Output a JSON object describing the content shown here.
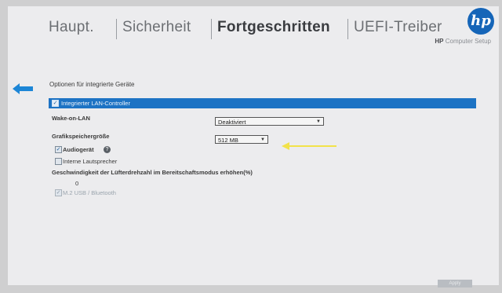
{
  "tabs": [
    {
      "label": "Haupt."
    },
    {
      "label": "Sicherheit"
    },
    {
      "label": "Fortgeschritten"
    },
    {
      "label": "UEFI-Treiber"
    }
  ],
  "brand": {
    "strong": "HP",
    "text": "Computer Setup",
    "logo": "hp"
  },
  "page_title": "Optionen für integrierte Geräte",
  "rows": {
    "lan": {
      "label": "Integrierter LAN-Controller",
      "checked": true
    },
    "wol": {
      "label": "Wake-on-LAN",
      "value": "Deaktiviert"
    },
    "gfx": {
      "label": "Grafikspeichergröße",
      "value": "512 MB"
    },
    "audio": {
      "label": "Audiogerät",
      "checked": true
    },
    "speaker": {
      "label": "Interne Lautsprecher",
      "checked": false
    },
    "fan": {
      "label": "Geschwindigkeit der Lüfterdrehzahl im Bereitschaftsmodus erhöhen(%)",
      "value": "0"
    },
    "m2": {
      "label": "M.2 USB / Bluetooth",
      "checked": true
    }
  },
  "apply_label": "Apply",
  "colors": {
    "accent": "#1d73c4",
    "annotation_arrow": "#f2e24a",
    "background": "#ececee"
  },
  "icons": [
    "back-arrow-icon",
    "info-icon",
    "chevron-down-icon",
    "hp-logo"
  ]
}
